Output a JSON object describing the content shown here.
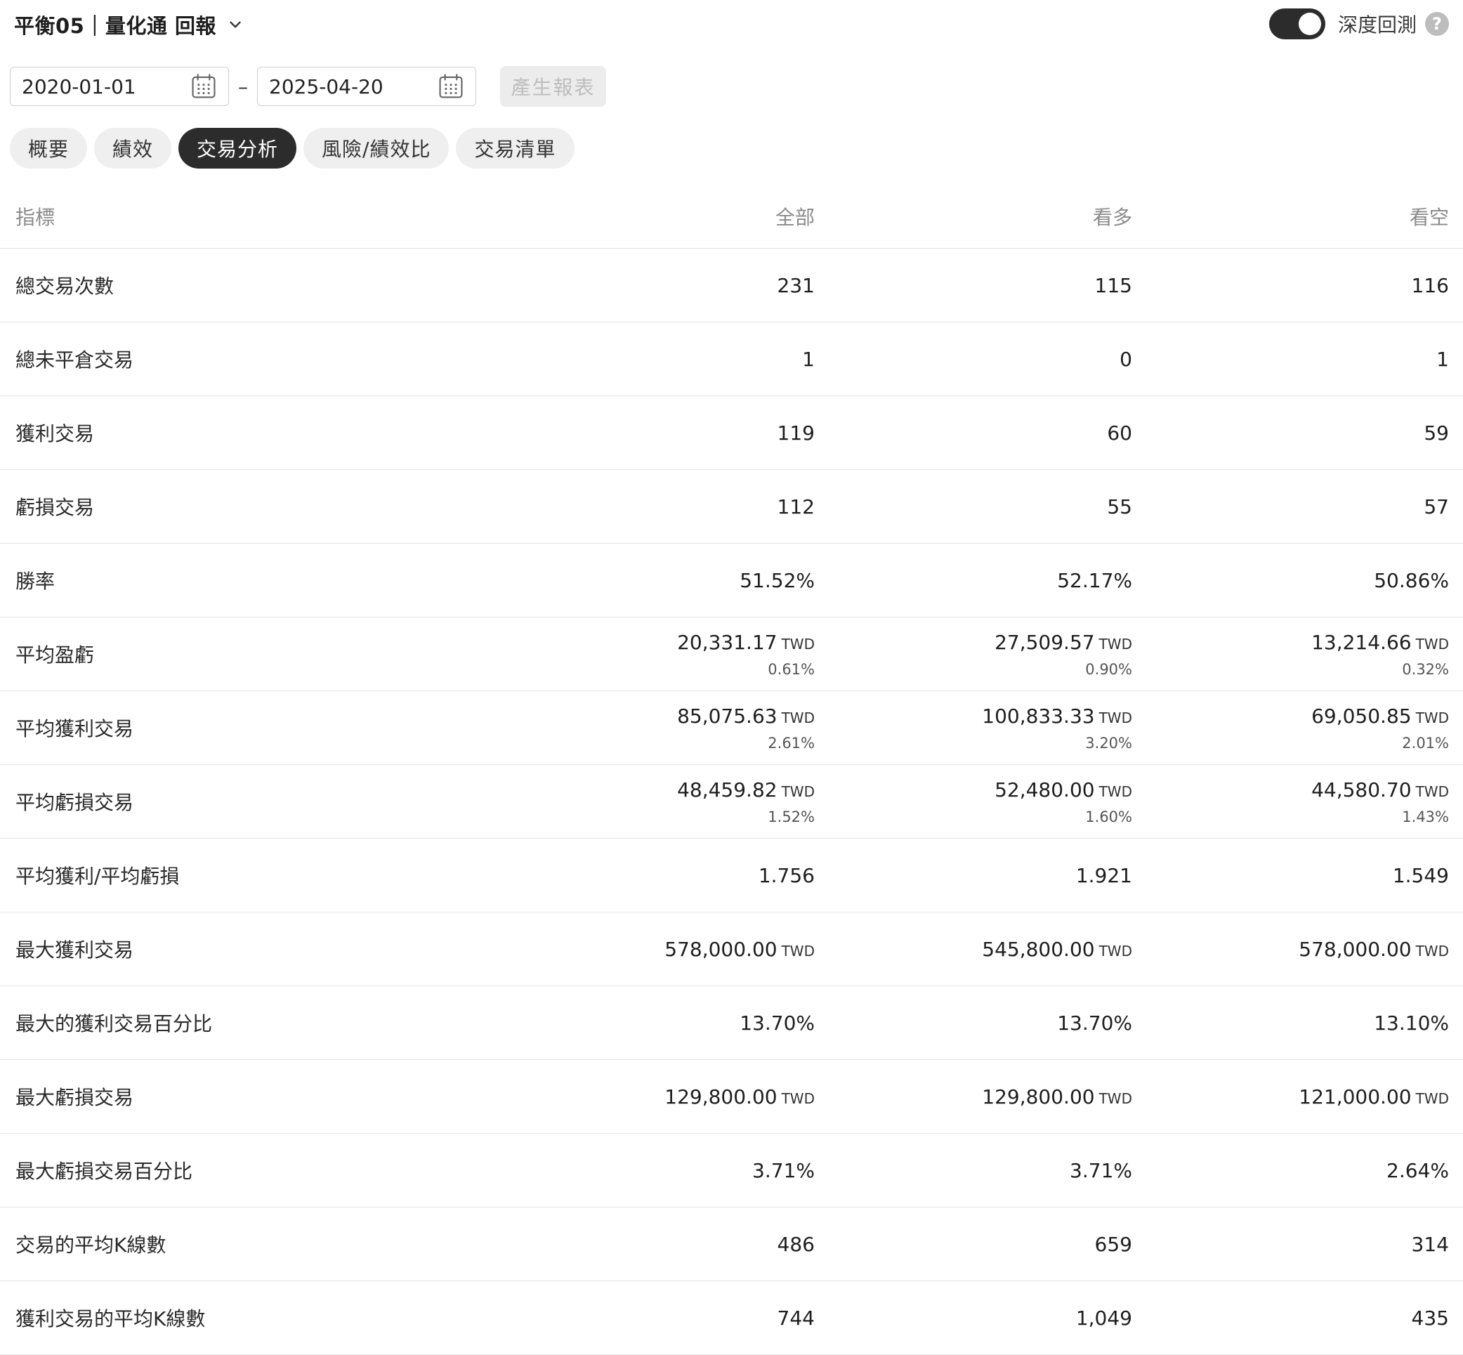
{
  "header": {
    "title": "平衡05｜量化通 回報",
    "deep_label": "深度回測",
    "deep_enabled": true,
    "help_symbol": "?"
  },
  "dates": {
    "start": "2020-01-01",
    "separator": "–",
    "end": "2025-04-20",
    "generate_label": "產生報表"
  },
  "tabs": [
    {
      "label": "概要",
      "active": false
    },
    {
      "label": "績效",
      "active": false
    },
    {
      "label": "交易分析",
      "active": true
    },
    {
      "label": "風險/績效比",
      "active": false
    },
    {
      "label": "交易清單",
      "active": false
    }
  ],
  "table": {
    "headers": [
      "指標",
      "全部",
      "看多",
      "看空"
    ],
    "rows": [
      {
        "label": "總交易次數",
        "values": [
          {
            "v": "231"
          },
          {
            "v": "115"
          },
          {
            "v": "116"
          }
        ]
      },
      {
        "label": "總未平倉交易",
        "values": [
          {
            "v": "1"
          },
          {
            "v": "0"
          },
          {
            "v": "1"
          }
        ]
      },
      {
        "label": "獲利交易",
        "values": [
          {
            "v": "119"
          },
          {
            "v": "60"
          },
          {
            "v": "59"
          }
        ]
      },
      {
        "label": "虧損交易",
        "values": [
          {
            "v": "112"
          },
          {
            "v": "55"
          },
          {
            "v": "57"
          }
        ]
      },
      {
        "label": "勝率",
        "values": [
          {
            "v": "51.52%"
          },
          {
            "v": "52.17%"
          },
          {
            "v": "50.86%"
          }
        ]
      },
      {
        "label": "平均盈虧",
        "values": [
          {
            "v": "20,331.17",
            "u": "TWD",
            "s": "0.61%"
          },
          {
            "v": "27,509.57",
            "u": "TWD",
            "s": "0.90%"
          },
          {
            "v": "13,214.66",
            "u": "TWD",
            "s": "0.32%"
          }
        ]
      },
      {
        "label": "平均獲利交易",
        "values": [
          {
            "v": "85,075.63",
            "u": "TWD",
            "s": "2.61%"
          },
          {
            "v": "100,833.33",
            "u": "TWD",
            "s": "3.20%"
          },
          {
            "v": "69,050.85",
            "u": "TWD",
            "s": "2.01%"
          }
        ]
      },
      {
        "label": "平均虧損交易",
        "values": [
          {
            "v": "48,459.82",
            "u": "TWD",
            "s": "1.52%"
          },
          {
            "v": "52,480.00",
            "u": "TWD",
            "s": "1.60%"
          },
          {
            "v": "44,580.70",
            "u": "TWD",
            "s": "1.43%"
          }
        ]
      },
      {
        "label": "平均獲利/平均虧損",
        "values": [
          {
            "v": "1.756"
          },
          {
            "v": "1.921"
          },
          {
            "v": "1.549"
          }
        ]
      },
      {
        "label": "最大獲利交易",
        "values": [
          {
            "v": "578,000.00",
            "u": "TWD"
          },
          {
            "v": "545,800.00",
            "u": "TWD"
          },
          {
            "v": "578,000.00",
            "u": "TWD"
          }
        ]
      },
      {
        "label": "最大的獲利交易百分比",
        "values": [
          {
            "v": "13.70%"
          },
          {
            "v": "13.70%"
          },
          {
            "v": "13.10%"
          }
        ]
      },
      {
        "label": "最大虧損交易",
        "values": [
          {
            "v": "129,800.00",
            "u": "TWD"
          },
          {
            "v": "129,800.00",
            "u": "TWD"
          },
          {
            "v": "121,000.00",
            "u": "TWD"
          }
        ]
      },
      {
        "label": "最大虧損交易百分比",
        "values": [
          {
            "v": "3.71%"
          },
          {
            "v": "3.71%"
          },
          {
            "v": "2.64%"
          }
        ]
      },
      {
        "label": "交易的平均K線數",
        "values": [
          {
            "v": "486"
          },
          {
            "v": "659"
          },
          {
            "v": "314"
          }
        ]
      },
      {
        "label": "獲利交易的平均K線數",
        "values": [
          {
            "v": "744"
          },
          {
            "v": "1,049"
          },
          {
            "v": "435"
          }
        ]
      }
    ]
  }
}
